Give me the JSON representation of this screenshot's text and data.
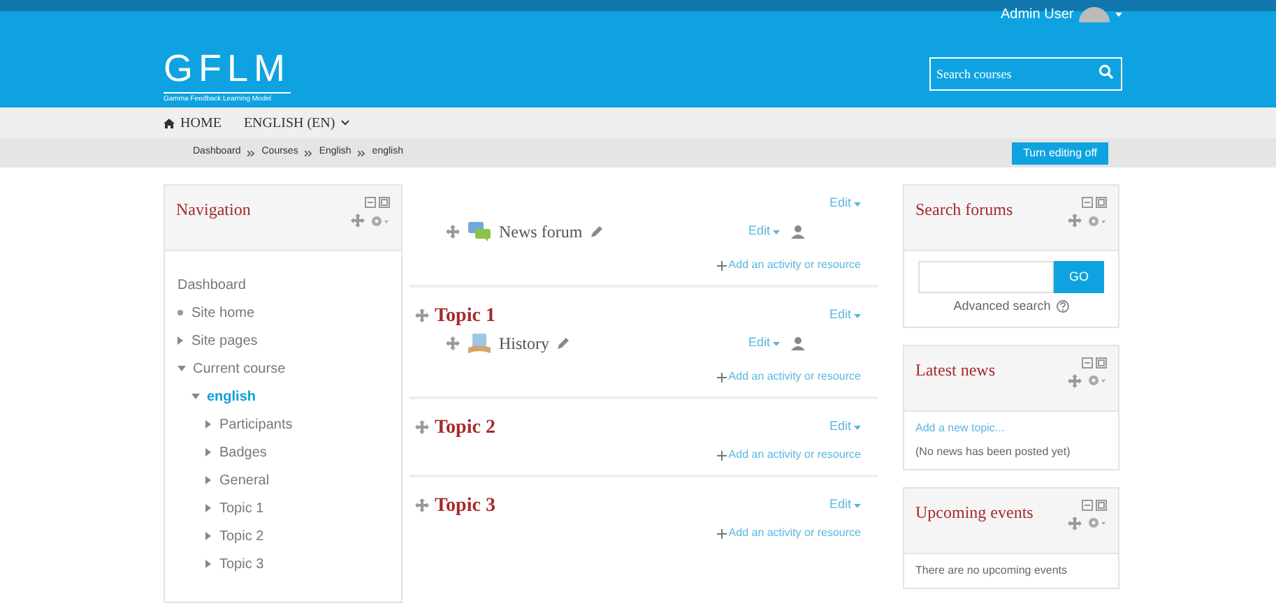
{
  "header": {
    "user": "Admin User",
    "logo": "GFLM",
    "tagline": "Gamma Feedback Learning Model",
    "search": {
      "placeholder": "Search courses"
    }
  },
  "menu": {
    "home": "HOME",
    "language": "ENGLISH (EN)"
  },
  "breadcrumb": [
    "Dashboard",
    "Courses",
    "English",
    "english"
  ],
  "editing_button": "Turn editing off",
  "navigation": {
    "title": "Navigation",
    "items": [
      {
        "label": "Dashboard",
        "kind": "plain"
      },
      {
        "label": "Site home",
        "kind": "leaf"
      },
      {
        "label": "Site pages",
        "kind": "branch",
        "expanded": false
      },
      {
        "label": "Current course",
        "kind": "branch",
        "expanded": true,
        "children": [
          {
            "label": "english",
            "kind": "branch",
            "expanded": true,
            "current": true,
            "children": [
              {
                "label": "Participants",
                "kind": "branch",
                "expanded": false
              },
              {
                "label": "Badges",
                "kind": "branch",
                "expanded": false
              },
              {
                "label": "General",
                "kind": "branch",
                "expanded": false
              },
              {
                "label": "Topic 1",
                "kind": "branch",
                "expanded": false
              },
              {
                "label": "Topic 2",
                "kind": "branch",
                "expanded": false
              },
              {
                "label": "Topic 3",
                "kind": "branch",
                "expanded": false
              }
            ]
          }
        ]
      }
    ]
  },
  "sections": [
    {
      "edit": "Edit",
      "activities": [
        {
          "name": "News forum",
          "kind": "forum",
          "edit": "Edit"
        }
      ],
      "add": "Add an activity or resource"
    },
    {
      "title": "Topic 1",
      "edit": "Edit",
      "activities": [
        {
          "name": "History",
          "kind": "book",
          "edit": "Edit"
        }
      ],
      "add": "Add an activity or resource"
    },
    {
      "title": "Topic 2",
      "edit": "Edit",
      "add": "Add an activity or resource"
    },
    {
      "title": "Topic 3",
      "edit": "Edit",
      "add": "Add an activity or resource"
    }
  ],
  "blocks": [
    {
      "kind": "search",
      "title": "Search forums",
      "button": "GO",
      "link": "Advanced search"
    },
    {
      "kind": "news",
      "title": "Latest news",
      "link": "Add a new topic...",
      "text": "(No news has been posted yet)"
    },
    {
      "kind": "events",
      "title": "Upcoming events",
      "text": "There are no upcoming events"
    }
  ]
}
